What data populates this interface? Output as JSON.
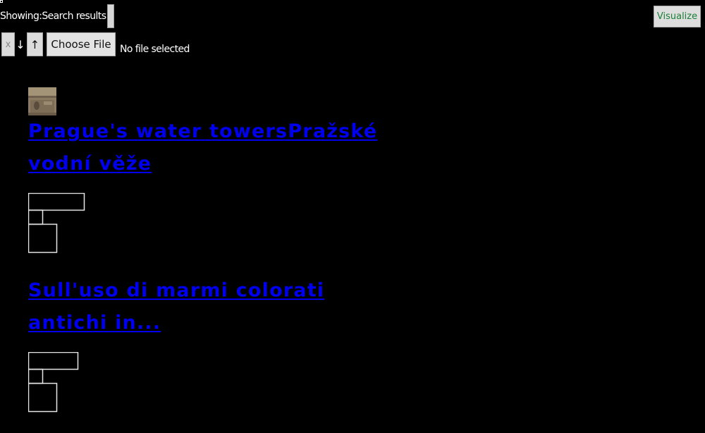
{
  "header": {
    "showing_label": "Showing:",
    "showing_value": "Search results",
    "visualize_label": "Visualize"
  },
  "toolbar": {
    "clear_label": "x",
    "sort_desc_label": "↓",
    "sort_asc_label": "↑",
    "choose_file_label": "Choose File",
    "file_status": "No file selected"
  },
  "colors": {
    "background": "#000000",
    "link": "#0000ee",
    "visualize_text": "#1a7f37"
  },
  "results": [
    {
      "title": "Prague's water towersPražské vodní věže",
      "thumbnail": "photo-thumbnail"
    },
    {
      "title": "Sull'uso di marmi colorati antichi in...",
      "thumbnail": "placeholder-layout-icon"
    },
    {
      "title": "",
      "thumbnail": "placeholder-layout-icon"
    }
  ]
}
